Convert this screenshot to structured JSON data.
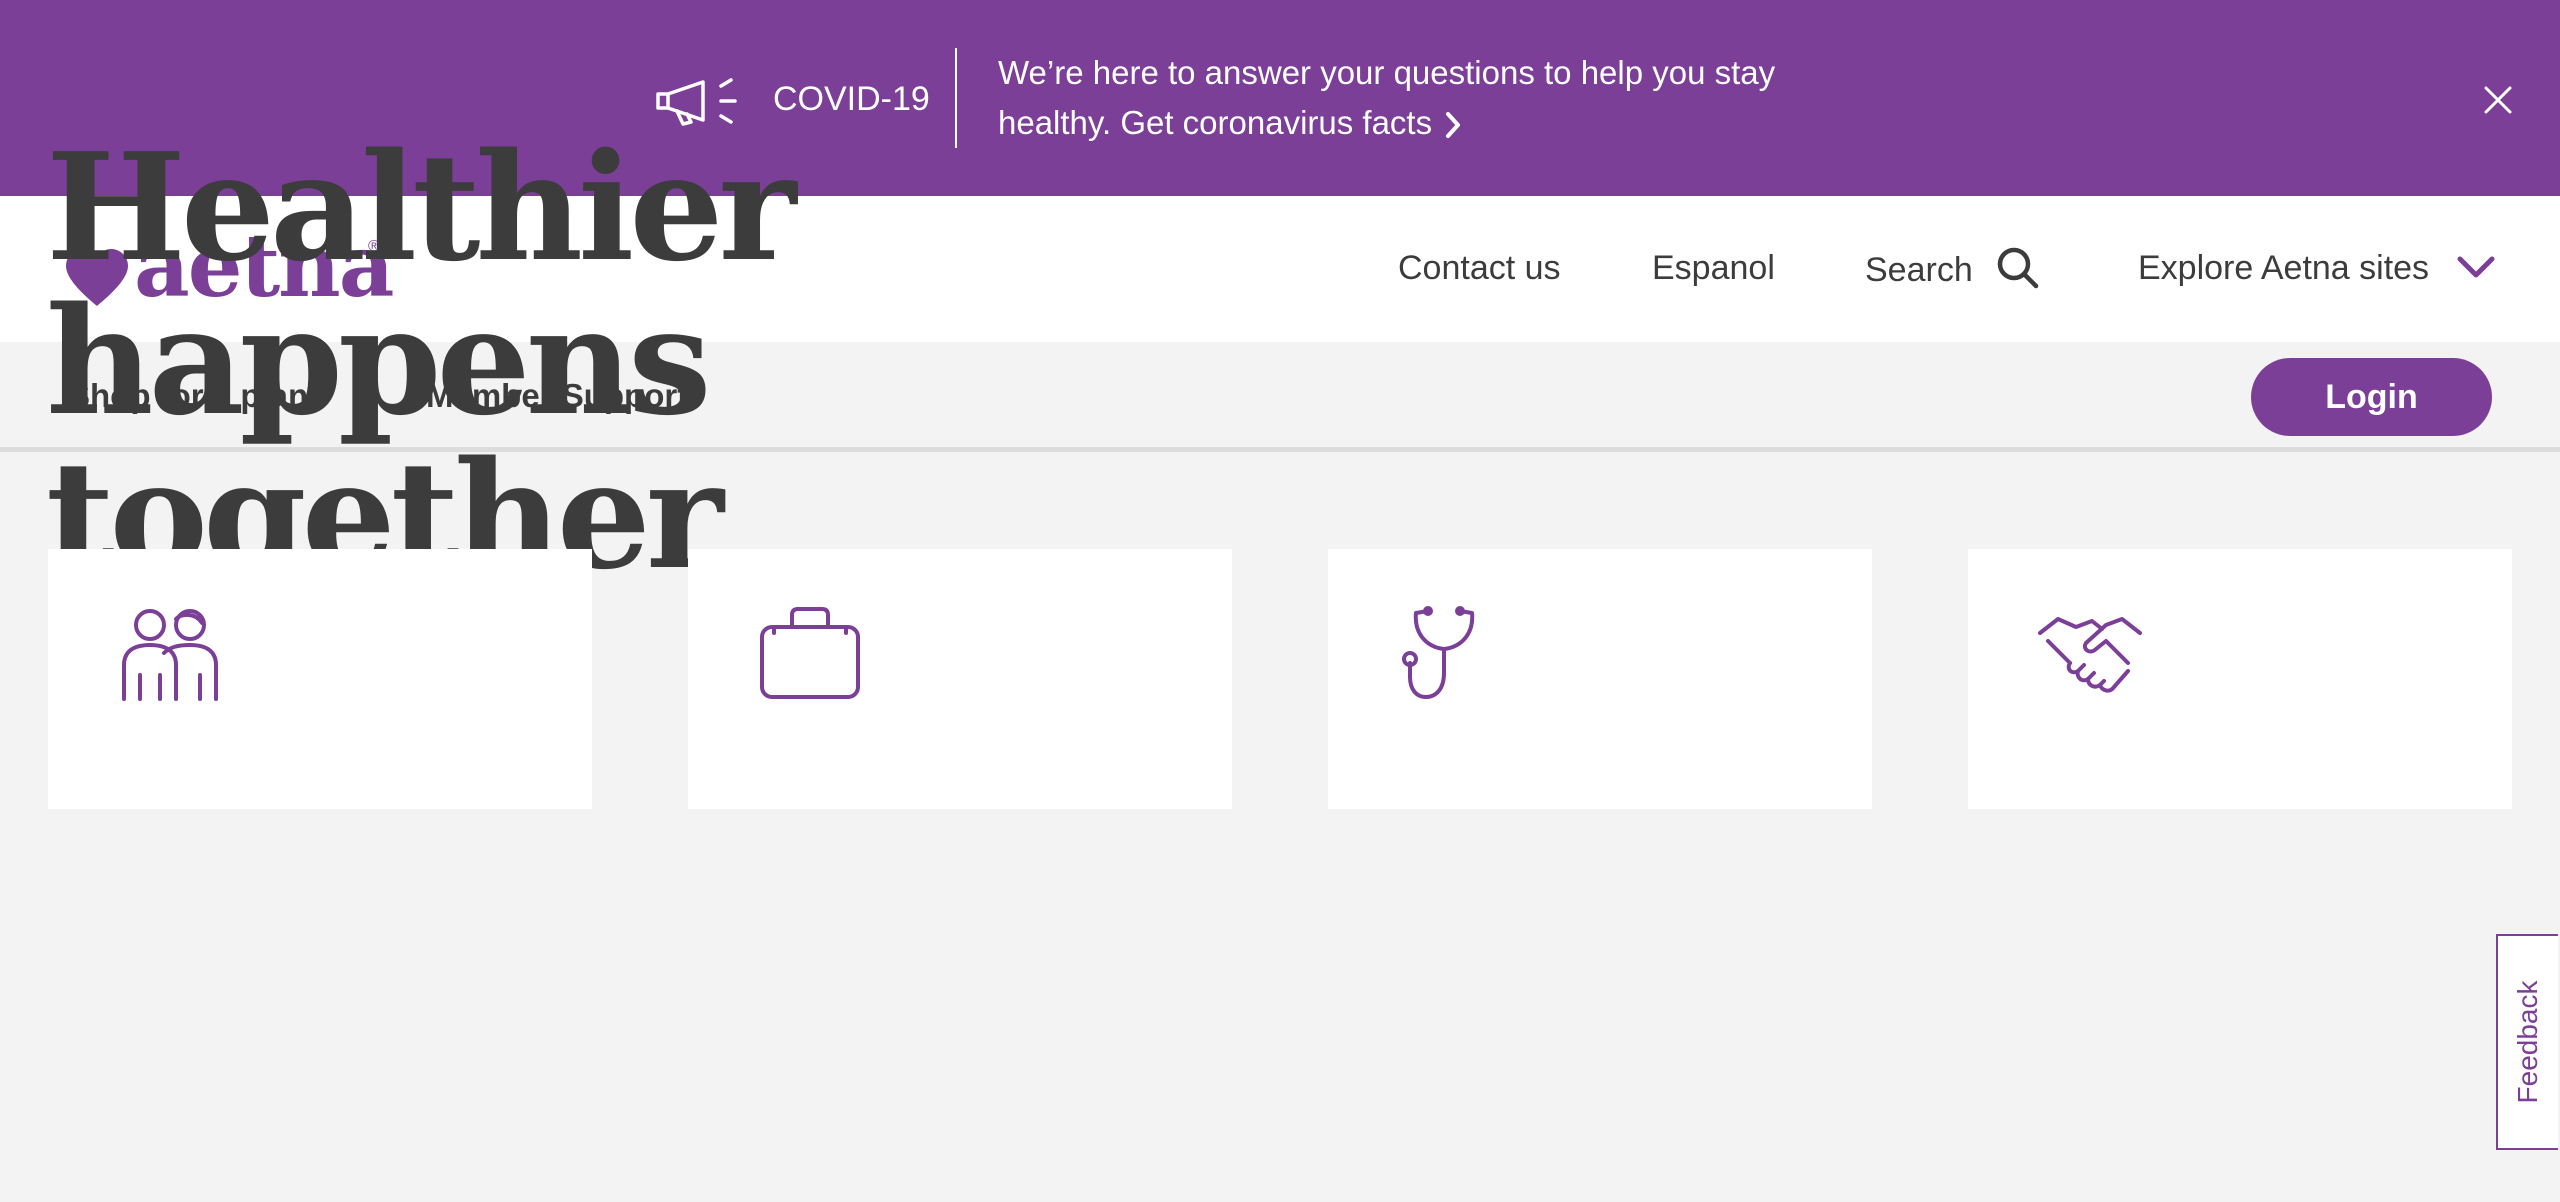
{
  "banner": {
    "label": "COVID-19",
    "message": "We’re here to answer your questions to help you stay healthy.",
    "link_text": "Get coronavirus facts",
    "color": "#7c3f98",
    "icons": [
      "megaphone-icon",
      "chevron-right-icon",
      "close-icon"
    ]
  },
  "header": {
    "logo_text": "aetna",
    "logo_reg": "®",
    "contact": "Contact us",
    "espanol": "Espanol",
    "search": "Search",
    "explore": "Explore Aetna sites",
    "icons": [
      "heart-icon",
      "search-icon",
      "chevron-down-icon"
    ]
  },
  "nav": {
    "shop": "Shop for a plan",
    "member_support": "Member Support",
    "login": "Login"
  },
  "hero": {
    "title_line1": "Healthier happens",
    "title_line2": "together",
    "photo": "family-photo"
  },
  "cards": [
    {
      "icon": "family-icon"
    },
    {
      "icon": "briefcase-icon"
    },
    {
      "icon": "stethoscope-icon"
    },
    {
      "icon": "handshake-icon"
    }
  ],
  "feedback": "Feedback",
  "colors": {
    "brand_purple": "#7c3f98",
    "text_dark": "#3c3c3c",
    "page_bg": "#f3f3f3"
  }
}
